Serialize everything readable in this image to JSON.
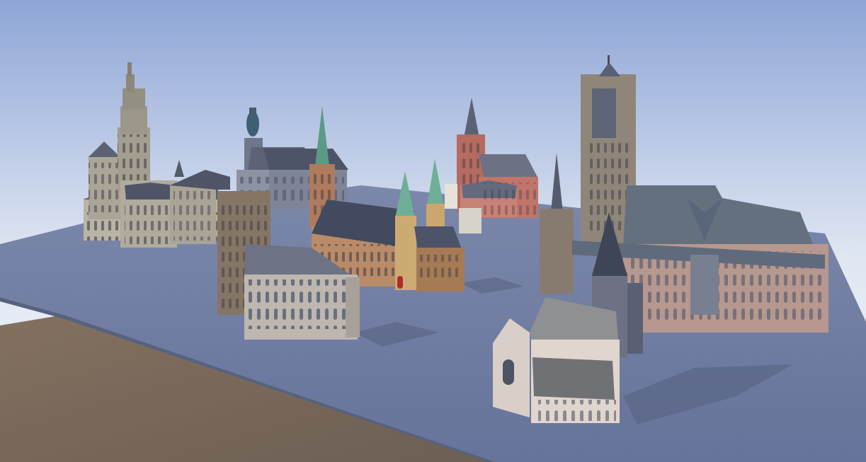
{
  "scene": {
    "colors": {
      "sky_top": "#8ea5d6",
      "sky_bottom": "#f4f7fb",
      "platform_top": "#6f7c9e",
      "platform_side": "#5b6788",
      "ground": "#7a6a5c"
    },
    "models": [
      {
        "name": "gothic-cathedral-with-ornate-tower"
      },
      {
        "name": "domed-tower-church"
      },
      {
        "name": "green-spire-church"
      },
      {
        "name": "red-brick-spire-church"
      },
      {
        "name": "twin-green-spire-church"
      },
      {
        "name": "stone-tower-chapel"
      },
      {
        "name": "large-gothic-cathedral-with-square-tower"
      },
      {
        "name": "small-stepped-gable-church"
      }
    ]
  }
}
